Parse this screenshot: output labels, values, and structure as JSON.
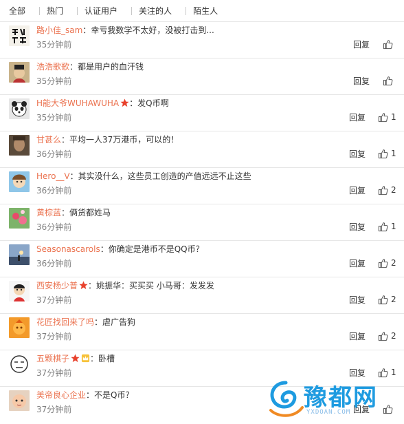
{
  "filter_tabs": [
    "全部",
    "热门",
    "认证用户",
    "关注的人",
    "陌生人"
  ],
  "reply_label": "回复",
  "colors": {
    "username": "#eb7350",
    "text": "#333333",
    "meta": "#808080",
    "watermark": "#1e9be0"
  },
  "comments": [
    {
      "user": "路小佳_sam",
      "text": "幸亏我数学不太好，没被打击到...",
      "time": "35分钟前",
      "likes": "",
      "avatar_icon": "calligraphy-avatar",
      "badges": []
    },
    {
      "user": "浩浩歌歌",
      "text": "都是用户的血汗钱",
      "time": "35分钟前",
      "likes": "",
      "avatar_icon": "emperor-avatar",
      "badges": []
    },
    {
      "user": "H能大爷WUHAWUHA",
      "text": "发Q币啊",
      "time": "35分钟前",
      "likes": "1",
      "avatar_icon": "panda-avatar",
      "badges": [
        "star-badge"
      ]
    },
    {
      "user": "甘甚么",
      "text": "平均一人37万港币，可以的！",
      "time": "36分钟前",
      "likes": "1",
      "avatar_icon": "photo-avatar",
      "badges": []
    },
    {
      "user": "Hero__V",
      "text": "其实没什么，这些员工创造的产值远远不止这些",
      "time": "36分钟前",
      "likes": "2",
      "avatar_icon": "cartoon-avatar",
      "badges": []
    },
    {
      "user": "黄棕蓝",
      "text": "俩货都姓马",
      "time": "36分钟前",
      "likes": "1",
      "avatar_icon": "flower-avatar",
      "badges": []
    },
    {
      "user": "Seasonascarols",
      "text": "你确定是港币不是QQ币？",
      "time": "36分钟前",
      "likes": "2",
      "avatar_icon": "sunset-avatar",
      "badges": []
    },
    {
      "user": "西安杨少普",
      "text": "姚振华：买买买    小马哥：发发发",
      "time": "37分钟前",
      "likes": "2",
      "avatar_icon": "boy-avatar",
      "badges": [
        "star-badge"
      ]
    },
    {
      "user": "花匠找回来了吗",
      "text": "虐广告狗",
      "time": "37分钟前",
      "likes": "2",
      "avatar_icon": "orange-avatar",
      "badges": []
    },
    {
      "user": "五颗棋子",
      "text": "卧槽",
      "time": "37分钟前",
      "likes": "1",
      "avatar_icon": "meme-avatar",
      "badges": [
        "star-badge",
        "crown-badge"
      ]
    },
    {
      "user": "美帝良心企业",
      "text": "不是Q币？",
      "time": "37分钟前",
      "likes": "",
      "avatar_icon": "baby-avatar",
      "badges": []
    }
  ],
  "watermark": {
    "text": "豫都网",
    "sub": "YXDOAN.COM"
  }
}
